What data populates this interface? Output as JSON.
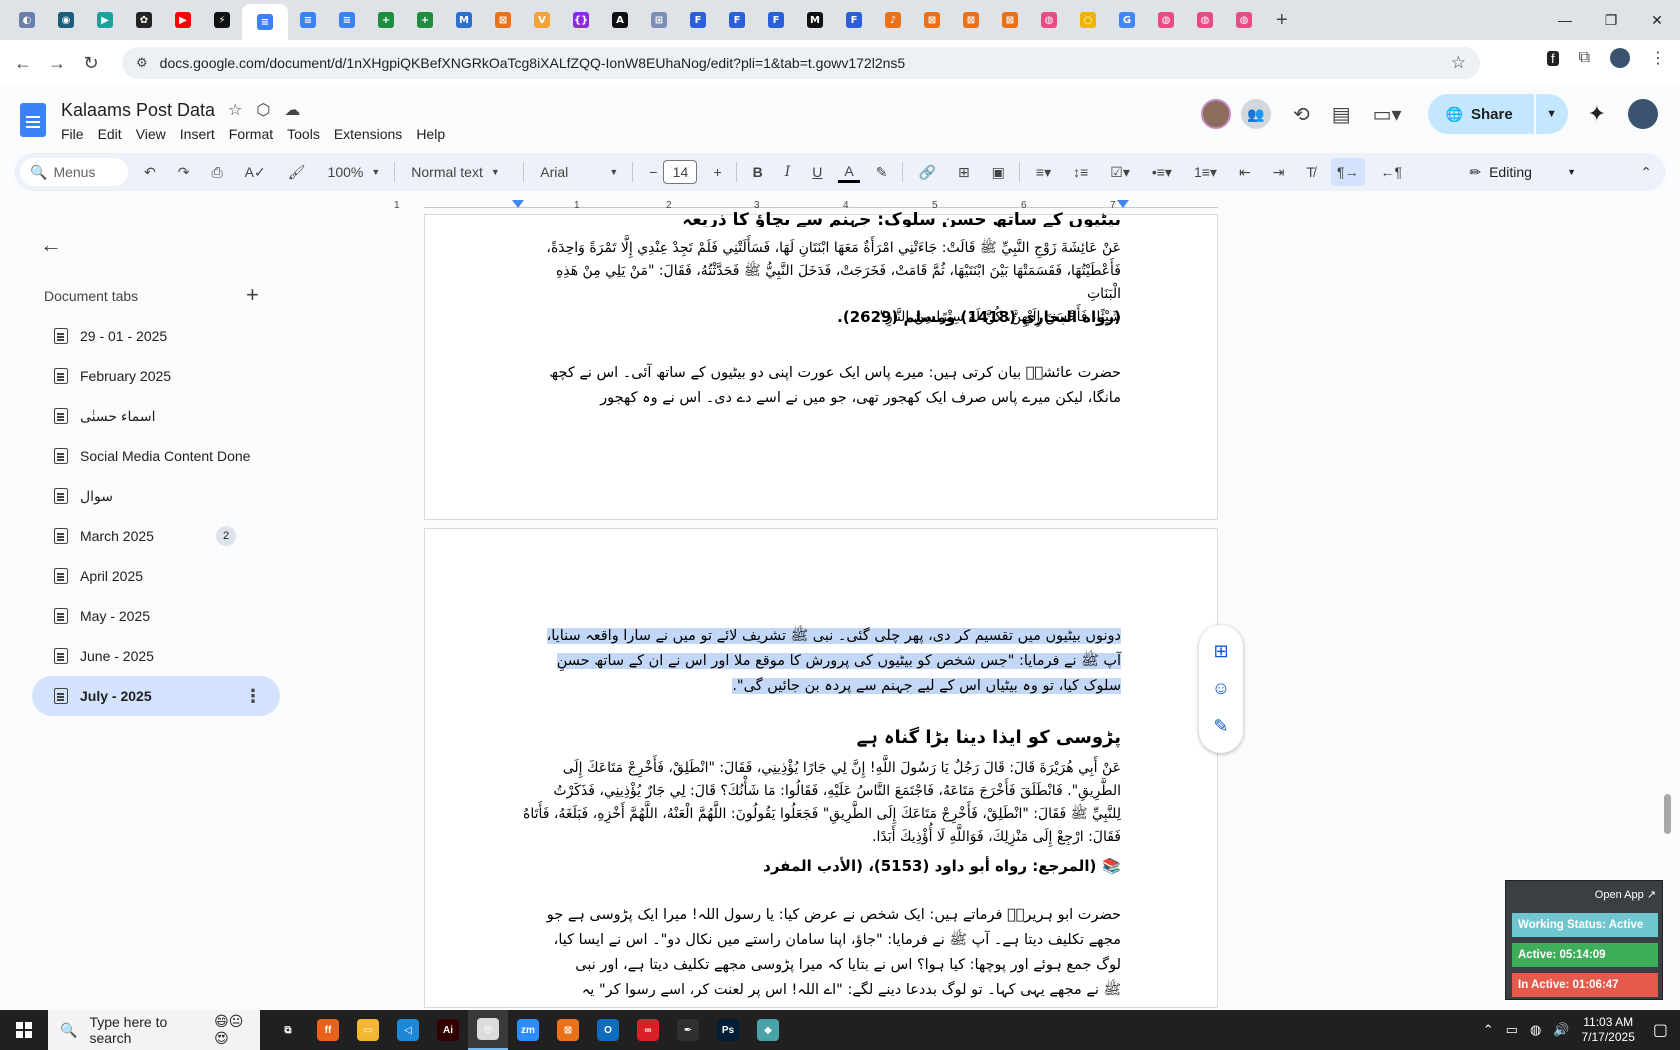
{
  "browser": {
    "tabs": [
      {
        "icon": "tab-icon-1",
        "color": "#6b7fa8",
        "glyph": "◐"
      },
      {
        "icon": "tab-icon-2",
        "color": "#1b5e7a",
        "glyph": "◉"
      },
      {
        "icon": "tab-icon-3",
        "color": "#1aa39a",
        "glyph": "▶"
      },
      {
        "icon": "tab-icon-4",
        "color": "#222222",
        "glyph": "✿"
      },
      {
        "icon": "youtube-icon",
        "color": "#ff0000",
        "glyph": "▶"
      },
      {
        "icon": "tab-icon-6",
        "color": "#111111",
        "glyph": "⚡"
      },
      {
        "icon": "docs-icon",
        "color": "#3c82f6",
        "glyph": "≡",
        "active": true
      },
      {
        "icon": "docs-icon",
        "color": "#3c82f6",
        "glyph": "≡"
      },
      {
        "icon": "docs-icon",
        "color": "#3c82f6",
        "glyph": "≡"
      },
      {
        "icon": "sheets-icon",
        "color": "#1e8e3e",
        "glyph": "+"
      },
      {
        "icon": "sheets-icon",
        "color": "#1e8e3e",
        "glyph": "+"
      },
      {
        "icon": "tab-icon-12",
        "color": "#2c6fd1",
        "glyph": "M"
      },
      {
        "icon": "tab-icon-13",
        "color": "#e8711a",
        "glyph": "⊠"
      },
      {
        "icon": "tab-icon-14",
        "color": "#f2a33a",
        "glyph": "V"
      },
      {
        "icon": "tab-icon-15",
        "color": "#8a2be2",
        "glyph": "{}"
      },
      {
        "icon": "tab-icon-16",
        "color": "#111111",
        "glyph": "A"
      },
      {
        "icon": "tab-icon-17",
        "color": "#7c8eb5",
        "glyph": "⊞"
      },
      {
        "icon": "tab-icon-18",
        "color": "#2b5fd9",
        "glyph": "F"
      },
      {
        "icon": "tab-icon-19",
        "color": "#2b5fd9",
        "glyph": "F"
      },
      {
        "icon": "tab-icon-20",
        "color": "#2b5fd9",
        "glyph": "F"
      },
      {
        "icon": "tab-icon-21",
        "color": "#111111",
        "glyph": "M"
      },
      {
        "icon": "tab-icon-22",
        "color": "#2b5fd9",
        "glyph": "F"
      },
      {
        "icon": "tab-icon-23",
        "color": "#e8711a",
        "glyph": "♪"
      },
      {
        "icon": "tab-icon-24",
        "color": "#e8711a",
        "glyph": "⊠"
      },
      {
        "icon": "tab-icon-25",
        "color": "#e8711a",
        "glyph": "⊠"
      },
      {
        "icon": "tab-icon-26",
        "color": "#e8711a",
        "glyph": "⊠"
      },
      {
        "icon": "tab-icon-27",
        "color": "#e84c88",
        "glyph": "◍"
      },
      {
        "icon": "tab-icon-28",
        "color": "#f0b400",
        "glyph": "○"
      },
      {
        "icon": "google-icon",
        "color": "#4285f4",
        "glyph": "G"
      },
      {
        "icon": "tab-icon-30",
        "color": "#e84c88",
        "glyph": "◍"
      },
      {
        "icon": "tab-icon-31",
        "color": "#e84c88",
        "glyph": "◍"
      },
      {
        "icon": "tab-icon-32",
        "color": "#e84c88",
        "glyph": "◍"
      }
    ],
    "url": "docs.google.com/document/d/1nXHgpiQKBefXNGRkOaTcg8iXALfZQQ-IonW8EUhaNog/edit?pli=1&tab=t.gowv172l2ns5"
  },
  "doc": {
    "title": "Kalaams Post Data",
    "menu": [
      "File",
      "Edit",
      "View",
      "Insert",
      "Format",
      "Tools",
      "Extensions",
      "Help"
    ],
    "share_label": "Share"
  },
  "toolbar": {
    "menus_label": "Menus",
    "zoom": "100%",
    "style": "Normal text",
    "font": "Arial",
    "font_size": "14",
    "mode": "Editing"
  },
  "ruler": {
    "marks": [
      "1",
      "1",
      "2",
      "3",
      "4",
      "5",
      "6",
      "7"
    ]
  },
  "sidebar": {
    "title": "Document tabs",
    "tabs": [
      {
        "label": "29 - 01 - 2025"
      },
      {
        "label": "February 2025"
      },
      {
        "label": "اسماء حسنٰی"
      },
      {
        "label": "Social Media Content Done"
      },
      {
        "label": "سوال"
      },
      {
        "label": "March 2025",
        "badge": "2"
      },
      {
        "label": "April 2025"
      },
      {
        "label": "May - 2025"
      },
      {
        "label": "June - 2025"
      },
      {
        "label": "July - 2025",
        "selected": true
      }
    ]
  },
  "page1": {
    "heading": "بیٹیوں کے ساتھ حسنِ سلوک: جہنم سے بچاؤ کا ذریعہ",
    "arabic": [
      "عَنْ عَائِشَةَ زَوْجِ النَّبِيِّ ﷺ قَالَتْ: جَاءَتْنِي امْرَأَةٌ مَعَهَا ابْنَتَانِ لَهَا، فَسَأَلَتْنِي فَلَمْ تَجِدْ عِنْدِي إِلَّا تَمْرَةً وَاحِدَةً،",
      "فَأَعْطَيْتُهَا، فَقَسَمَتْهَا بَيْنَ ابْنَتَيْهَا، ثُمَّ قَامَتْ، فَخَرَجَتْ، فَدَخَلَ النَّبِيُّ ﷺ فَحَدَّثْتُهُ، فَقَالَ: \"مَنْ يَلِي مِنْ هَذِهِ الْبَنَاتِ",
      "شَيْئًا، فَأَحْسَنَ إِلَيْهِنَّ، كُنَّ لَهُ سِتْرًا مِنَ النَّارِ\"."
    ],
    "reference": "(رواه البخاري (1418) ومسلم (2629).",
    "urdu": [
      "حضرت عائشہؓ بیان کرتی ہیں: میرے پاس ایک عورت اپنی دو بیٹیوں کے ساتھ آئی۔ اس نے کچھ",
      "مانگا، لیکن میرے پاس صرف ایک کھجور تھی، جو میں نے اسے دے دی۔ اس نے وہ کھجور"
    ]
  },
  "page2": {
    "urdu_selected": [
      "دونوں بیٹیوں میں تقسیم کر دی، پھر چلی گئی۔ نبی ﷺ تشریف لائے تو میں نے سارا واقعہ سنایا،",
      "آپ ﷺ نے فرمایا: \"جس شخص کو بیٹیوں کی پرورش کا موقع ملا اور اس نے ان کے ساتھ حسنِ",
      "سلوک کیا، تو وہ بیٹیاں اس کے لیے جہنم سے پردہ بن جائیں گی\"."
    ],
    "heading": "پڑوسی کو ایذا دینا بڑا گناہ ہے",
    "arabic": [
      "عَنْ أَبِي هُرَيْرَةَ قَالَ: قَالَ رَجُلٌ يَا رَسُولَ اللَّهِ! إِنَّ لِي جَارًا يُؤْذِينِي، فَقَالَ: \"انْطَلِقْ، فَأَخْرِجْ مَتَاعَكَ إِلَى",
      "الطَّرِيقِ\". فَانْطَلَقَ فَأَخْرَجَ مَتَاعَهُ، فَاجْتَمَعَ النَّاسُ عَلَيْهِ، فَقَالُوا: مَا شَأْنُكَ؟ قَالَ: لِي جَارٌ يُؤْذِينِي، فَذَكَرْتُ",
      "لِلنَّبِيِّ ﷺ فَقَالَ: \"انْطَلِقْ، فَأَخْرِجْ مَتَاعَكَ إِلَى الطَّرِيقِ\" فَجَعَلُوا يَقُولُونَ: اللَّهُمَّ الْعَنْهُ، اللَّهُمَّ أَخْزِهِ، فَبَلَغَهُ، فَأَتَاهُ",
      "فَقَالَ: ارْجِعْ إِلَى مَنْزِلِكَ، فَوَاللَّهِ لَا أُؤْذِيكَ أَبَدًا."
    ],
    "reference": "(المرجع: رواه أبو داود (5153)، (الأدب المفرد",
    "urdu": [
      "حضرت ابو ہریرہؓ فرماتے ہیں: ایک شخص نے عرض کیا: یا رسول اللہ! میرا ایک پڑوسی ہے جو",
      "مجھے تکلیف دیتا ہے۔ آپ ﷺ نے فرمایا: \"جاؤ، اپنا سامان راستے میں نکال دو\"۔ اس نے ایسا کیا،",
      "لوگ جمع ہوئے اور پوچھا: کیا ہوا؟ اس نے بتایا کہ میرا پڑوسی مجھے تکلیف دیتا ہے، اور نبی",
      "ﷺ نے مجھے یہی کہا۔ تو لوگ بددعا دینے لگے: \"اے اللہ! اس پر لعنت کر، اسے رسوا کر\" یہ"
    ]
  },
  "widget": {
    "open_app": "Open App ↗",
    "status": "Working Status: Active",
    "active": "Active: 05:14:09",
    "inactive": "In Active: 01:06:47",
    "colors": {
      "status": "#6fc6cf",
      "active": "#3fae5a",
      "inactive": "#e45a4c"
    }
  },
  "taskbar": {
    "search_placeholder": "Type here to search",
    "apps": [
      {
        "icon": "task-view-icon",
        "color": "#202020",
        "glyph": "⧉"
      },
      {
        "icon": "firefox-icon",
        "color": "#e8631a",
        "glyph": "ff"
      },
      {
        "icon": "file-explorer-icon",
        "color": "#f2b632",
        "glyph": "▭"
      },
      {
        "icon": "vscode-icon",
        "color": "#1e88d8",
        "glyph": "◁"
      },
      {
        "icon": "illustrator-icon",
        "color": "#330000",
        "glyph": "Ai"
      },
      {
        "icon": "chrome-icon",
        "color": "#dcdcdc",
        "glyph": "◎",
        "active": true
      },
      {
        "icon": "zoom-icon",
        "color": "#2d8cff",
        "glyph": "zm"
      },
      {
        "icon": "postman-icon",
        "color": "#e8711a",
        "glyph": "⊠"
      },
      {
        "icon": "outlook-icon",
        "color": "#0f6cbd",
        "glyph": "O"
      },
      {
        "icon": "creative-cloud-icon",
        "color": "#da1f26",
        "glyph": "∞"
      },
      {
        "icon": "pen-tool-icon",
        "color": "#303030",
        "glyph": "✒"
      },
      {
        "icon": "photoshop-icon",
        "color": "#001e36",
        "glyph": "Ps"
      },
      {
        "icon": "app-icon",
        "color": "#4aa3a8",
        "glyph": "◆"
      }
    ],
    "time": "11:03 AM",
    "date": "7/17/2025"
  }
}
